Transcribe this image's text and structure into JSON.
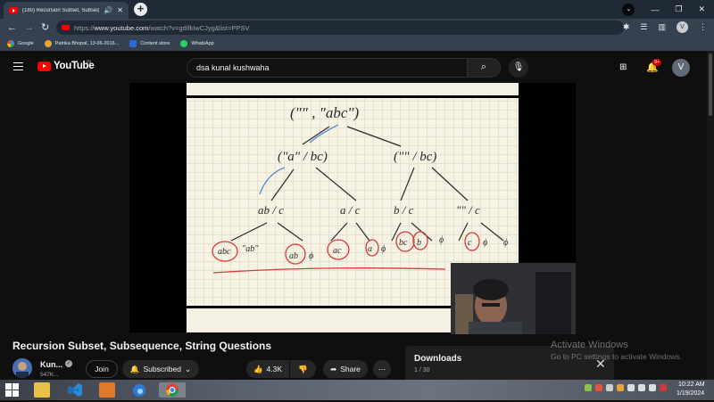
{
  "browser": {
    "tab_title": "(180) Recursion Subset, Subsequence...",
    "url_prefix": "https://",
    "url_host": "www.youtube.com",
    "url_path": "/watch?v=gdifkIwCJyg&list=PPSV",
    "bookmarks": [
      "Google",
      "Patrika Bhopal, 13-06-2016...",
      "Content store",
      "WhatsApp"
    ],
    "profile_initial": "V"
  },
  "youtube": {
    "logo_text": "YouTube",
    "logo_region": "IN",
    "search_value": "dsa kunal kushwaha",
    "notification_count": "9+",
    "avatar_initial": "V"
  },
  "whiteboard": {
    "root": "(\"\" , \"abc\")",
    "level1_left": "(\"a\" / bc)",
    "level1_right": "(\"\" / bc)",
    "level2": [
      "ab / c",
      "a / c",
      "b / c",
      "\"\" / c"
    ],
    "leaves": [
      "abc",
      "\"ab\"",
      "ab",
      "ϕ",
      "ac",
      "a",
      "ϕ",
      "bc",
      "b",
      "ϕ",
      "c",
      "ϕ",
      "ϕ"
    ]
  },
  "video": {
    "title": "Recursion Subset, Subsequence, String Questions",
    "channel_name": "Kun...",
    "subscribers": "547K...",
    "join_label": "Join",
    "subscribed_label": "Subscribed",
    "like_count": "4.3K",
    "share_label": "Share"
  },
  "downloads": {
    "title": "Downloads",
    "count": "1 / 30"
  },
  "watermark": {
    "line1": "Activate Windows",
    "line2": "Go to PC settings to activate Windows."
  },
  "taskbar": {
    "time": "10:22 AM",
    "date": "1/19/2024"
  },
  "colors": {
    "youtube_red": "#ff0000",
    "whiteboard_ink": "#2a2a2a",
    "circle_red": "#d63a3a",
    "arrow_blue": "#5b8fd6"
  }
}
